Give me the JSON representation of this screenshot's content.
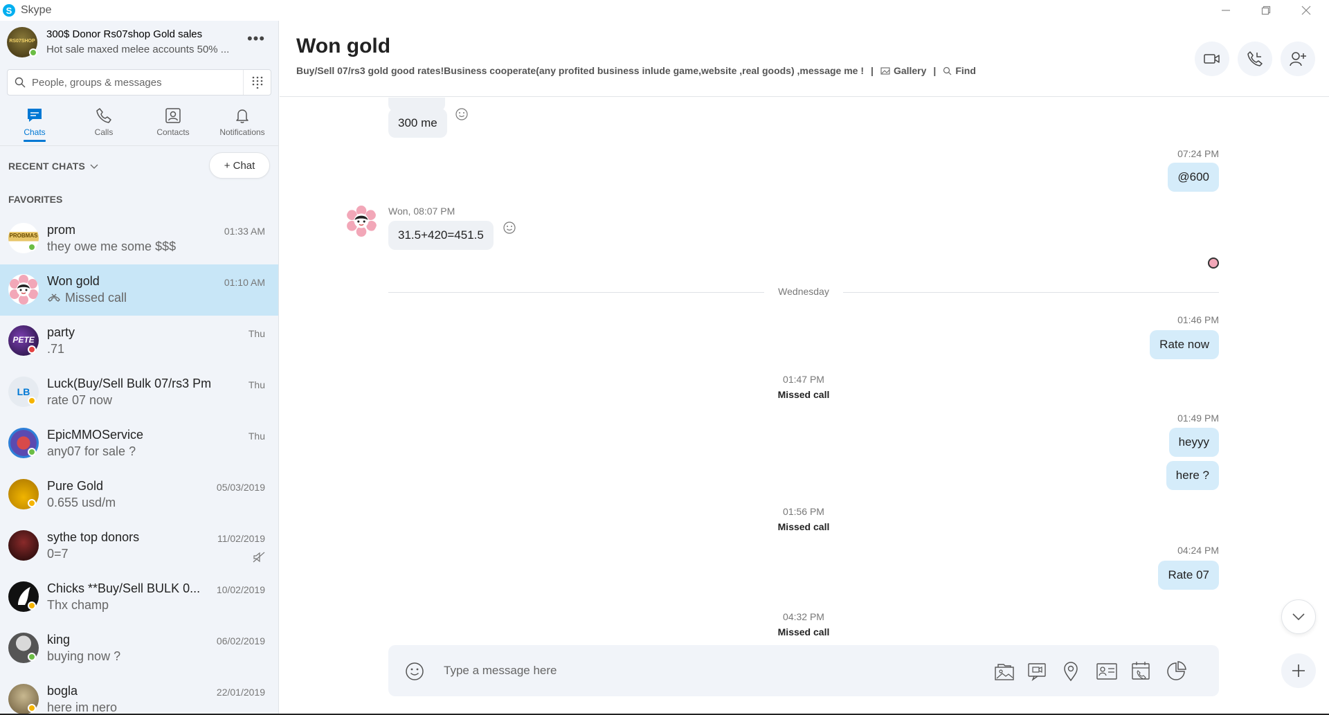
{
  "window": {
    "app_title": "Skype"
  },
  "profile": {
    "name": "300$ Donor Rs07shop  Gold sales",
    "mood": "Hot sale maxed melee accounts 50% ...",
    "more_label": "•••",
    "avatar_text": "RS07SHOP"
  },
  "search": {
    "placeholder": "People, groups & messages"
  },
  "nav": {
    "tabs": [
      {
        "label": "Chats",
        "active": true
      },
      {
        "label": "Calls"
      },
      {
        "label": "Contacts"
      },
      {
        "label": "Notifications"
      }
    ]
  },
  "recent": {
    "header": "RECENT CHATS",
    "new_chat_label": "+ Chat",
    "favorites_header": "FAVORITES"
  },
  "chats": [
    {
      "name": "prom",
      "preview": "they owe me some $$$",
      "time": "01:33 AM",
      "presence": "online"
    },
    {
      "name": "Won gold",
      "preview": "Missed call",
      "time": "01:10 AM",
      "selected": true
    },
    {
      "name": "party",
      "preview": ".71",
      "time": "Thu",
      "presence": "busy",
      "avatar_text": "PETE"
    },
    {
      "name": "Luck(Buy/Sell Bulk 07/rs3 Pm )",
      "preview": "rate 07 now",
      "time": "Thu",
      "presence": "away",
      "avatar_text": "LB"
    },
    {
      "name": "EpicMMOService",
      "preview": "any07 for sale ?",
      "time": "Thu",
      "presence": "online"
    },
    {
      "name": "Pure Gold",
      "preview": "0.655 usd/m",
      "time": "05/03/2019",
      "presence": "away"
    },
    {
      "name": "sythe top donors",
      "preview": "0=7",
      "time": "11/02/2019",
      "muted": true
    },
    {
      "name": "Chicks **Buy/Sell BULK 0...",
      "preview": "Thx champ",
      "time": "10/02/2019",
      "presence": "away"
    },
    {
      "name": "king",
      "preview": "buying now ?",
      "time": "06/02/2019",
      "presence": "online"
    },
    {
      "name": "bogla",
      "preview": "here im nero",
      "time": "22/01/2019",
      "presence": "away"
    }
  ],
  "conversation": {
    "title": "Won gold",
    "subtitle": "Buy/Sell 07/rs3 gold good rates!Business cooperate(any profited business inlude game,website ,real goods) ,message me !",
    "gallery_label": "Gallery",
    "find_label": "Find",
    "sep": "|"
  },
  "messages": {
    "m1": "300 me",
    "t2": "07:24 PM",
    "m2": "@600",
    "t3": "Won, 08:07 PM",
    "m3": "31.5+420=451.5",
    "day": "Wednesday",
    "t4": "01:46 PM",
    "m4": "Rate now",
    "s1_time": "01:47 PM",
    "s1_text": "Missed call",
    "t5": "01:49 PM",
    "m5": "heyyy",
    "m6": "here ?",
    "s2_time": "01:56 PM",
    "s2_text": "Missed call",
    "t6": "04:24 PM",
    "m7": "Rate 07",
    "s3_time": "04:32 PM",
    "s3_text": "Missed call"
  },
  "composer": {
    "placeholder": "Type a message here"
  },
  "colors": {
    "accent": "#0078d4",
    "selected": "#c8e6f7",
    "outgoing": "#d5ecfa",
    "incoming": "#eef1f5",
    "sidebar": "#f1f4f9"
  }
}
